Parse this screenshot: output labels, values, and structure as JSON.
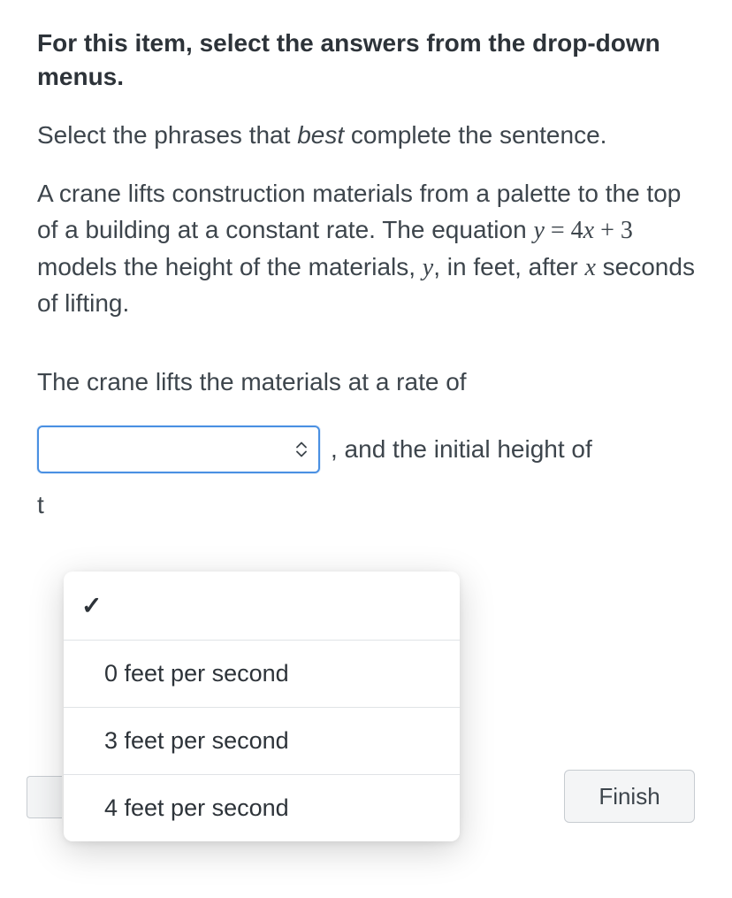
{
  "instruction_bold": "For this item, select the answers from the drop-down menus.",
  "subinstruction_pre": "Select the phrases that ",
  "subinstruction_em": "best",
  "subinstruction_post": " complete the sentence.",
  "problem_pre": "A crane lifts construction materials from a palette to the top of a building at a constant rate. The equation ",
  "problem_eq_y": "y",
  "problem_eq_mid": " = 4",
  "problem_eq_x": "x",
  "problem_eq_post": " + 3",
  "problem_mid": " models the height of the materials, ",
  "problem_y2": "y",
  "problem_after_y2": ", in feet, after ",
  "problem_x2": "x",
  "problem_tail": " seconds of lifting.",
  "sentence_lead": "The crane lifts the materials at a rate of",
  "after_select": ", and the initial height of",
  "row2_char": "t",
  "dropdown": {
    "options": [
      {
        "label": "",
        "selected": true
      },
      {
        "label": "0 feet per second",
        "selected": false
      },
      {
        "label": "3 feet per second",
        "selected": false
      },
      {
        "label": "4 feet per second",
        "selected": false
      }
    ]
  },
  "finish_label": "Finish",
  "checkmark": "✓"
}
